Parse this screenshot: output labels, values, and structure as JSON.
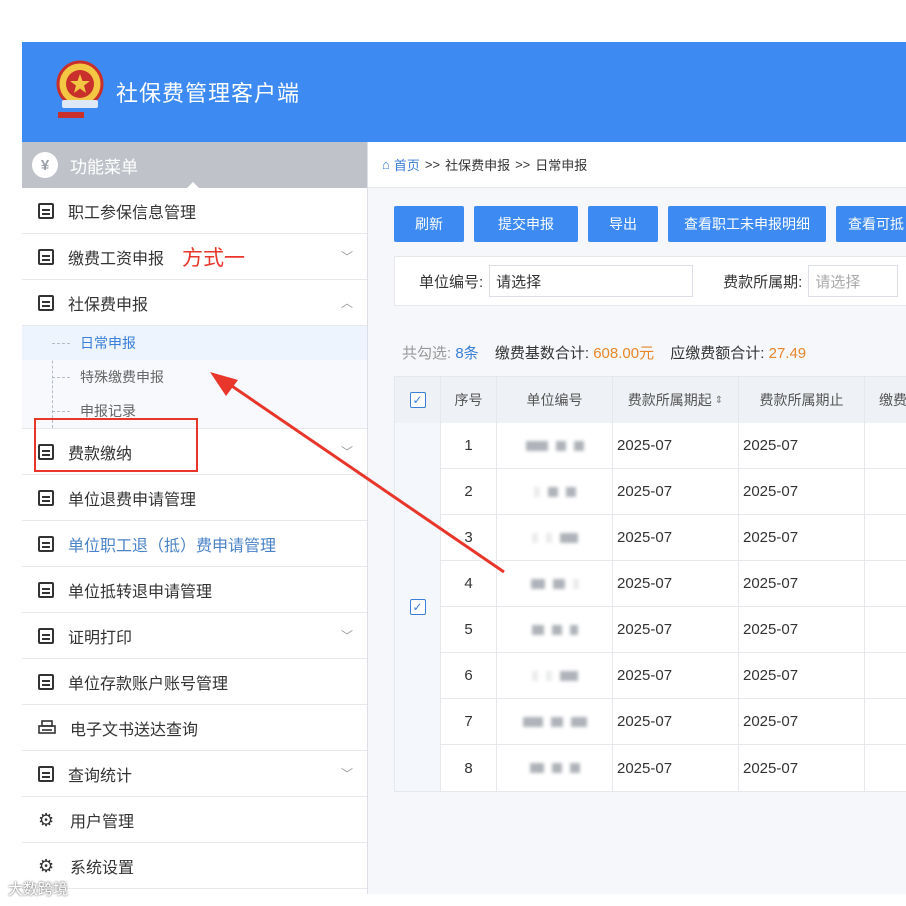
{
  "app": {
    "title": "社保费管理客户端"
  },
  "sidebar": {
    "header": "功能菜单",
    "items": [
      {
        "label": "职工参保信息管理",
        "icon": "list-icon"
      },
      {
        "label": "缴费工资申报",
        "icon": "edit-icon",
        "annotation": "方式一"
      },
      {
        "label": "社保费申报",
        "icon": "calendar-icon",
        "children": [
          "日常申报",
          "特殊缴费申报",
          "申报记录"
        ]
      },
      {
        "label": "费款缴纳",
        "icon": "book-icon"
      },
      {
        "label": "单位退费申请管理",
        "icon": "list-icon"
      },
      {
        "label": "单位职工退（抵）费申请管理",
        "icon": "list-icon"
      },
      {
        "label": "单位抵转退申请管理",
        "icon": "list-icon"
      },
      {
        "label": "证明打印",
        "icon": "document-icon"
      },
      {
        "label": "单位存款账户账号管理",
        "icon": "book-icon"
      },
      {
        "label": "电子文书送达查询",
        "icon": "printer-icon"
      },
      {
        "label": "查询统计",
        "icon": "chart-icon"
      },
      {
        "label": "用户管理",
        "icon": "gear-icon"
      },
      {
        "label": "系统设置",
        "icon": "gear-icon"
      }
    ]
  },
  "breadcrumb": {
    "home": "首页",
    "sep": ">>",
    "level1": "社保费申报",
    "level2": "日常申报"
  },
  "toolbar": {
    "refresh": "刷新",
    "submit": "提交申报",
    "export": "导出",
    "view_undeclared": "查看职工未申报明细",
    "view_more": "查看可抵"
  },
  "filter": {
    "unit_label": "单位编号:",
    "unit_value": "请选择",
    "period_label": "费款所属期:",
    "period_placeholder": "请选择"
  },
  "summary": {
    "selected_prefix": "共勾选:",
    "selected_count": "8条",
    "base_label": "缴费基数合计:",
    "base_value": "608.00元",
    "due_label": "应缴费额合计:",
    "due_value": "27.49"
  },
  "table": {
    "headers": [
      "序号",
      "单位编号",
      "费款所属期起",
      "费款所属期止",
      "缴费"
    ],
    "rows": [
      {
        "no": "1",
        "start": "2025-07",
        "end": "2025-07"
      },
      {
        "no": "2",
        "start": "2025-07",
        "end": "2025-07"
      },
      {
        "no": "3",
        "start": "2025-07",
        "end": "2025-07"
      },
      {
        "no": "4",
        "start": "2025-07",
        "end": "2025-07"
      },
      {
        "no": "5",
        "start": "2025-07",
        "end": "2025-07"
      },
      {
        "no": "6",
        "start": "2025-07",
        "end": "2025-07"
      },
      {
        "no": "7",
        "start": "2025-07",
        "end": "2025-07"
      },
      {
        "no": "8",
        "start": "2025-07",
        "end": "2025-07"
      }
    ]
  },
  "watermark": "大数跨境",
  "colors": {
    "primary": "#3d8bf2",
    "annotation": "#e8362b",
    "amount": "#e8862b"
  }
}
